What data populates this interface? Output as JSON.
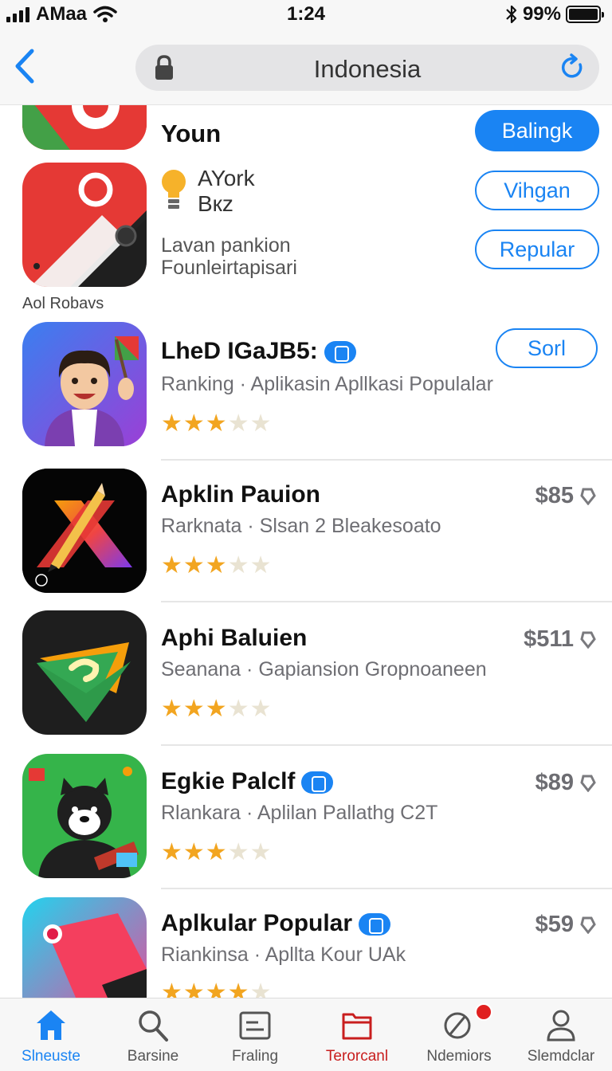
{
  "status_bar": {
    "carrier": "AMaa",
    "time": "1:24",
    "battery": "99%"
  },
  "nav": {
    "address": "Indonesia"
  },
  "featured": {
    "title": "Youn",
    "get_button": "Balingk",
    "bulb_title_line1": "AYork",
    "bulb_title_line2": "Bкz",
    "desc_line1": "Lavan pankion",
    "desc_line2": "Founleirtapisari",
    "buttons": [
      "Vihgan",
      "Repular"
    ],
    "caption": "Aol Robavs"
  },
  "apps": [
    {
      "name": "LheD IGaJB5:",
      "subtitle": "Ranking  ·  Aplikasin Apllkasi Populalar",
      "rating": 3,
      "action": "Sorl",
      "badge": true
    },
    {
      "name": "Apklin Pauion",
      "subtitle": "Rarknata  ·  Slsan 2 Bleakesoato",
      "rating": 3,
      "price": "$85",
      "badge": false
    },
    {
      "name": "Aphi Baluien",
      "subtitle": "Seanana  ·  Gapiansion Gropnoaneen",
      "rating": 3,
      "price": "$511",
      "badge": false
    },
    {
      "name": "Egkie Palclf",
      "subtitle": "Rlankara  ·  Aplilan Pallathg C2T",
      "rating": 3,
      "price": "$89",
      "badge": true
    },
    {
      "name": "Aplkular Popular",
      "subtitle": "Riankinsa  ·  Apllta Kour UAk",
      "rating": 4,
      "price": "$59",
      "badge": true
    }
  ],
  "tabs": [
    {
      "label": "Slneuste",
      "icon": "home-icon",
      "state": "active"
    },
    {
      "label": "Barsine",
      "icon": "search-icon",
      "state": "normal"
    },
    {
      "label": "Fraling",
      "icon": "list-icon",
      "state": "normal"
    },
    {
      "label": "Terorcanl",
      "icon": "folder-icon",
      "state": "alert"
    },
    {
      "label": "Ndemiors",
      "icon": "explore-icon",
      "state": "normal"
    },
    {
      "label": "Slemdclar",
      "icon": "person-icon",
      "state": "normal"
    }
  ],
  "colors": {
    "accent": "#1a84f3",
    "alert": "#c81e1e",
    "star": "#f2a520"
  }
}
